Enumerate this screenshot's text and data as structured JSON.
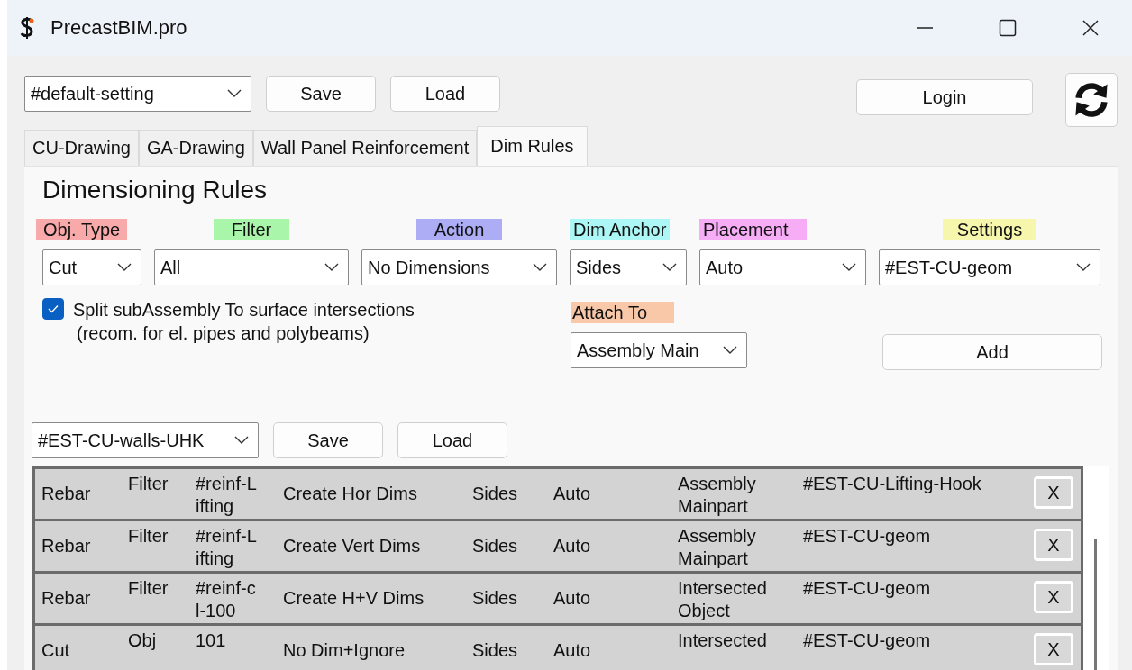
{
  "window": {
    "title": "PrecastBIM.pro"
  },
  "toolbar": {
    "setting": "#default-setting",
    "save": "Save",
    "load": "Load",
    "login": "Login"
  },
  "tabs": [
    {
      "label": "CU-Drawing",
      "selected": false
    },
    {
      "label": "GA-Drawing",
      "selected": false
    },
    {
      "label": "Wall Panel Reinforcement",
      "selected": false
    },
    {
      "label": "Dim Rules",
      "selected": true
    }
  ],
  "panel": {
    "heading": "Dimensioning Rules",
    "fields": [
      {
        "label": "Obj. Type",
        "color": "#f8a9a9",
        "value": "Cut"
      },
      {
        "label": "Filter",
        "color": "#a9f5a9",
        "value": "All"
      },
      {
        "label": "Action",
        "color": "#adadf6",
        "value": "No Dimensions"
      },
      {
        "label": "Dim Anchor",
        "color": "#adf6f6",
        "value": "Sides"
      },
      {
        "label": "Placement",
        "color": "#f6adf6",
        "value": "Auto"
      },
      {
        "label": "Settings",
        "color": "#f6f6ad",
        "value": "#EST-CU-geom"
      }
    ],
    "split_option": {
      "checked": true,
      "label": "Split subAssembly To surface intersections",
      "note": "(recom. for el. pipes and polybeams)"
    },
    "attach_to": {
      "label": "Attach To",
      "color": "#f8c8a8",
      "value": "Assembly Main"
    },
    "add": "Add"
  },
  "rules_toolbar": {
    "preset": "#EST-CU-walls-UHK",
    "save": "Save",
    "load": "Load"
  },
  "rules": [
    {
      "cells": [
        "Rebar",
        "Filter",
        "#reinf-Lifting",
        "Create Hor Dims",
        "Sides",
        "Auto",
        "Assembly Mainpart",
        "#EST-CU-Lifting-Hook"
      ],
      "delete": "X"
    },
    {
      "cells": [
        "Rebar",
        "Filter",
        "#reinf-Lifting",
        "Create Vert Dims",
        "Sides",
        "Auto",
        "Assembly Mainpart",
        "#EST-CU-geom"
      ],
      "delete": "X"
    },
    {
      "cells": [
        "Rebar",
        "Filter",
        "#reinf-cl-100",
        "Create H+V Dims",
        "Sides",
        "Auto",
        "Intersected Object",
        "#EST-CU-geom"
      ],
      "delete": "X"
    },
    {
      "cells": [
        "Cut",
        "Obj",
        "101",
        "No Dim+Ignore",
        "Sides",
        "Auto",
        "Intersected",
        "#EST-CU-geom"
      ],
      "delete": "X"
    }
  ]
}
